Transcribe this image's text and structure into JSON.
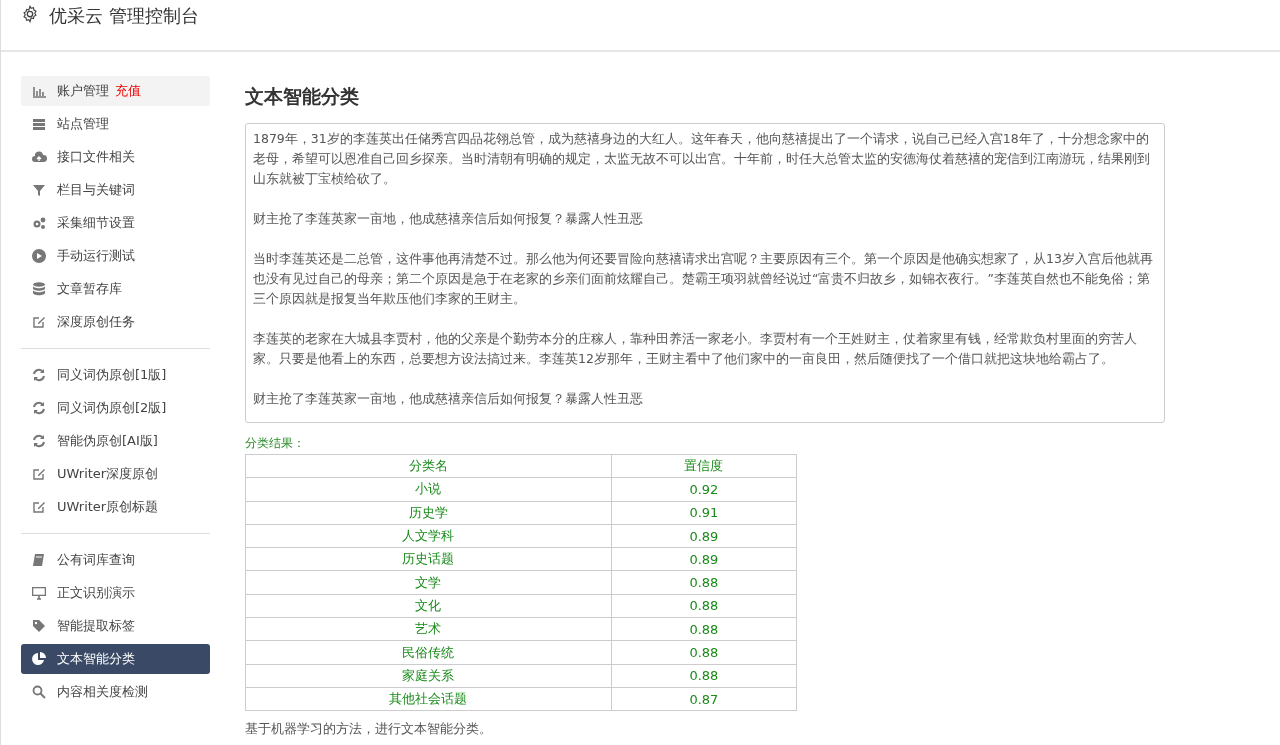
{
  "header": {
    "title": "优采云 管理控制台"
  },
  "sidebar": {
    "groups": [
      [
        {
          "label": "账户管理",
          "badge": "充值",
          "highlighted": true,
          "selected": false
        },
        {
          "label": "站点管理",
          "highlighted": false,
          "selected": false
        },
        {
          "label": "接口文件相关",
          "highlighted": false,
          "selected": false
        },
        {
          "label": "栏目与关键词",
          "highlighted": false,
          "selected": false
        },
        {
          "label": "采集细节设置",
          "highlighted": false,
          "selected": false
        },
        {
          "label": "手动运行测试",
          "highlighted": false,
          "selected": false
        },
        {
          "label": "文章暂存库",
          "highlighted": false,
          "selected": false
        },
        {
          "label": "深度原创任务",
          "highlighted": false,
          "selected": false
        }
      ],
      [
        {
          "label": "同义词伪原创[1版]",
          "highlighted": false,
          "selected": false
        },
        {
          "label": "同义词伪原创[2版]",
          "highlighted": false,
          "selected": false
        },
        {
          "label": "智能伪原创[AI版]",
          "highlighted": false,
          "selected": false
        },
        {
          "label": "UWriter深度原创",
          "highlighted": false,
          "selected": false
        },
        {
          "label": "UWriter原创标题",
          "highlighted": false,
          "selected": false
        }
      ],
      [
        {
          "label": "公有词库查询",
          "highlighted": false,
          "selected": false
        },
        {
          "label": "正文识别演示",
          "highlighted": false,
          "selected": false
        },
        {
          "label": "智能提取标签",
          "highlighted": false,
          "selected": false
        },
        {
          "label": "文本智能分类",
          "highlighted": false,
          "selected": true
        },
        {
          "label": "内容相关度检测",
          "highlighted": false,
          "selected": false
        }
      ]
    ]
  },
  "main": {
    "title": "文本智能分类",
    "input_text": [
      "1879年，31岁的李莲英出任储秀宫四品花翎总管，成为慈禧身边的大红人。这年春天，他向慈禧提出了一个请求，说自己已经入宫18年了，十分想念家中的老母，希望可以恩准自己回乡探亲。当时清朝有明确的规定，太监无故不可以出宫。十年前，时任大总管太监的安德海仗着慈禧的宠信到江南游玩，结果刚到山东就被丁宝桢给砍了。",
      "财主抢了李莲英家一亩地，他成慈禧亲信后如何报复？暴露人性丑恶",
      "当时李莲英还是二总管，这件事他再清楚不过。那么他为何还要冒险向慈禧请求出宫呢？主要原因有三个。第一个原因是他确实想家了，从13岁入宫后他就再也没有见过自己的母亲；第二个原因是急于在老家的乡亲们面前炫耀自己。楚霸王项羽就曾经说过“富贵不归故乡，如锦衣夜行。”李莲英自然也不能免俗；第三个原因就是报复当年欺压他们李家的王财主。",
      "李莲英的老家在大城县李贾村，他的父亲是个勤劳本分的庄稼人，靠种田养活一家老小。李贾村有一个王姓财主，仗着家里有钱，经常欺负村里面的穷苦人家。只要是他看上的东西，总要想方设法搞过来。李莲英12岁那年，王财主看中了他们家中的一亩良田，然后随便找了一个借口就把这块地给霸占了。",
      "财主抢了李莲英家一亩地，他成慈禧亲信后如何报复？暴露人性丑恶"
    ],
    "result_label": "分类结果：",
    "table": {
      "columns": [
        "分类名",
        "置信度"
      ],
      "rows": [
        [
          "小说",
          "0.92"
        ],
        [
          "历史学",
          "0.91"
        ],
        [
          "人文学科",
          "0.89"
        ],
        [
          "历史话题",
          "0.89"
        ],
        [
          "文学",
          "0.88"
        ],
        [
          "文化",
          "0.88"
        ],
        [
          "艺术",
          "0.88"
        ],
        [
          "民俗传统",
          "0.88"
        ],
        [
          "家庭关系",
          "0.88"
        ],
        [
          "其他社会话题",
          "0.87"
        ]
      ]
    },
    "footnote": "基于机器学习的方法，进行文本智能分类。"
  }
}
